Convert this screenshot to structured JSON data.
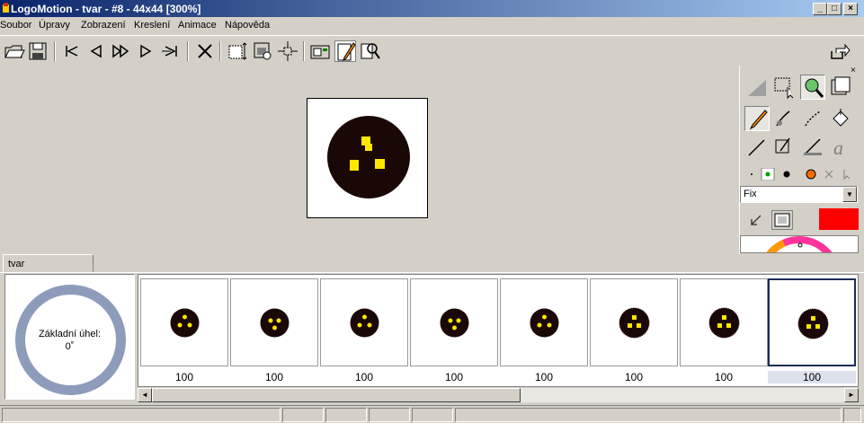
{
  "window": {
    "title": "LogoMotion - tvar - #8 - 44x44 [300%]",
    "controls": [
      "_",
      "□",
      "×"
    ]
  },
  "menu": [
    "Soubor",
    "Úpravy",
    "Zobrazení",
    "Kreslení",
    "Animace",
    "Nápověda"
  ],
  "toolbar": {
    "icons": [
      "open-icon",
      "save-icon",
      "first-frame-icon",
      "previous-frame-icon",
      "play-icon",
      "next-frame-icon",
      "last-frame-icon",
      "delete-frame-icon",
      "frame-size-icon",
      "frame-properties-icon",
      "move-icon",
      "preview-icon",
      "draw-mode-icon",
      "zoom-tool-icon",
      "exit-icon"
    ]
  },
  "right_panel": {
    "close": "×",
    "draw_mode": "Fix",
    "draw_mode_arrow": "▼",
    "active_color": "#ff0000"
  },
  "tabs": [
    "tvar"
  ],
  "base_angle": {
    "label": "Základní úhel:",
    "value": "0˚"
  },
  "frames": [
    {
      "value": "100",
      "variant": "a"
    },
    {
      "value": "100",
      "variant": "a"
    },
    {
      "value": "100",
      "variant": "a"
    },
    {
      "value": "100",
      "variant": "a"
    },
    {
      "value": "100",
      "variant": "a"
    },
    {
      "value": "100",
      "variant": "b"
    },
    {
      "value": "100",
      "variant": "b"
    },
    {
      "value": "100",
      "variant": "b",
      "selected": true
    }
  ],
  "scrollbar": {
    "left": "◄",
    "right": "►"
  },
  "colors": {
    "blob": "#1a0806",
    "dots": "#ffe600",
    "ring": "#8d9cbb"
  }
}
